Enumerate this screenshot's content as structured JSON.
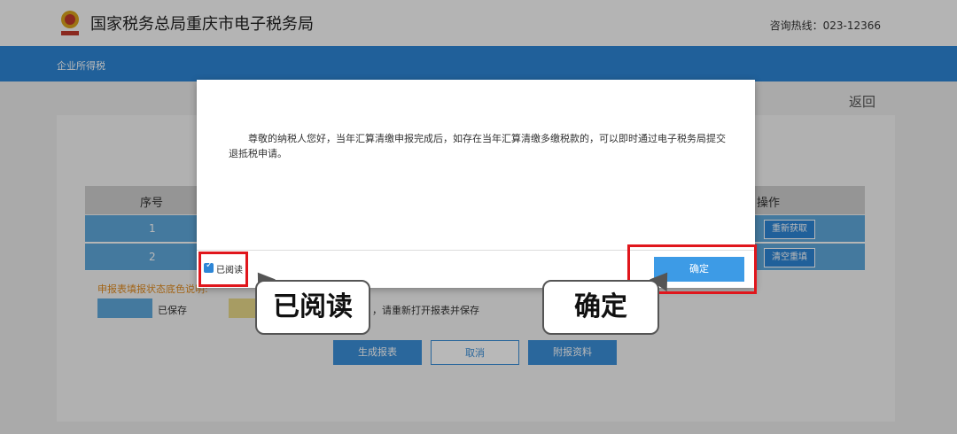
{
  "header": {
    "title": "国家税务总局重庆市电子税务局",
    "hotline": "咨询热线：023-12366",
    "logo_icon": "tax-emblem-icon"
  },
  "nav": {
    "title": "企业所得税"
  },
  "page": {
    "back_label": "返回",
    "table": {
      "headers": [
        "序号",
        "操作"
      ],
      "rows": [
        {
          "index": "1",
          "action": "重新获取"
        },
        {
          "index": "2",
          "action": "清空重填"
        }
      ]
    },
    "legend": {
      "title": "申报表填报状态底色说明:",
      "saved": "已保存",
      "changed": "，请重新打开报表并保存"
    },
    "buttons": {
      "generate": "生成报表",
      "cancel": "取消",
      "attach": "附报资料"
    }
  },
  "modal": {
    "message": "尊敬的纳税人您好，当年汇算清缴申报完成后，如存在当年汇算清缴多缴税款的，可以即时通过电子税务局提交退抵税申请。",
    "checkbox_label": "已阅读",
    "checkbox_checked": true,
    "confirm_label": "确定"
  },
  "annotations": {
    "read_callout": "已阅读",
    "confirm_callout": "确定",
    "highlight_color": "#e0161c"
  },
  "colors": {
    "primary": "#2d86d6",
    "row_blue": "#5fa8db",
    "legend_saved": "#5fa8db",
    "legend_changed": "#e8d98a",
    "legend_title": "#e08a1e"
  }
}
